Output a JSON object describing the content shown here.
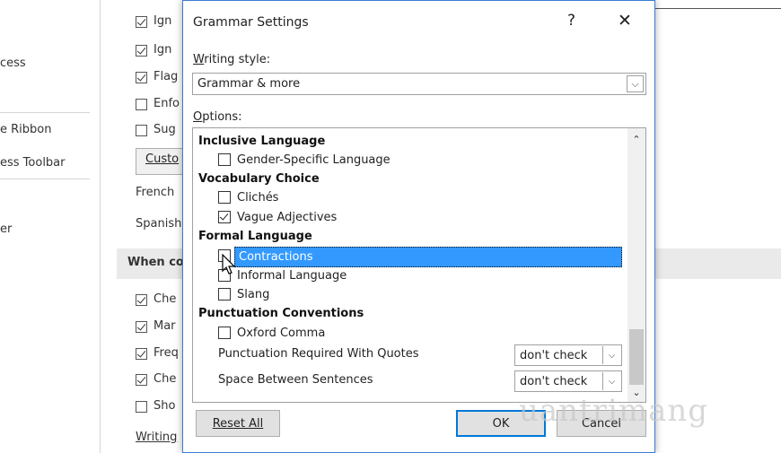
{
  "background": {
    "sidebar": [
      "cess",
      "e Ribbon",
      "ess Toolbar",
      "er"
    ],
    "checkboxes_top": [
      {
        "label": "Ign",
        "checked": true
      },
      {
        "label": "Ign",
        "checked": true
      },
      {
        "label": "Flag",
        "checked": true
      },
      {
        "label": "Enfo",
        "checked": false
      },
      {
        "label": "Sug",
        "checked": false
      }
    ],
    "custom_button": "Custo",
    "french_label": "French",
    "spanish_label": "Spanish",
    "section_label": "When co",
    "checkboxes_bottom": [
      {
        "label": "Che",
        "checked": true
      },
      {
        "label": "Mar",
        "checked": true
      },
      {
        "label": "Freq",
        "checked": true
      },
      {
        "label": "Che",
        "checked": true
      },
      {
        "label": "Sho",
        "checked": false
      }
    ],
    "writing_label": "Writing"
  },
  "dialog": {
    "title": "Grammar Settings",
    "help": "?",
    "close": "✕",
    "writing_style_label": "Writing style:",
    "writing_style_value": "Grammar & more",
    "options_label": "Options:",
    "options": [
      {
        "kind": "header",
        "label": "Inclusive Language"
      },
      {
        "kind": "item",
        "label": "Gender-Specific Language",
        "checked": false
      },
      {
        "kind": "header",
        "label": "Vocabulary Choice"
      },
      {
        "kind": "item",
        "label": "Clichés",
        "checked": false
      },
      {
        "kind": "item",
        "label": "Vague Adjectives",
        "checked": true
      },
      {
        "kind": "header",
        "label": "Formal Language"
      },
      {
        "kind": "item",
        "label": "Contractions",
        "checked": false,
        "selected": true
      },
      {
        "kind": "item",
        "label": "Informal Language",
        "checked": false
      },
      {
        "kind": "item",
        "label": "Slang",
        "checked": false
      },
      {
        "kind": "header",
        "label": "Punctuation Conventions"
      },
      {
        "kind": "item",
        "label": "Oxford Comma",
        "checked": false
      }
    ],
    "settings": [
      {
        "label": "Punctuation Required With Quotes",
        "value": "don't check"
      },
      {
        "label": "Space Between Sentences",
        "value": "don't check"
      }
    ],
    "buttons": {
      "reset": "Reset All",
      "ok": "OK",
      "cancel": "Cancel"
    }
  },
  "watermark": "uantrimang"
}
